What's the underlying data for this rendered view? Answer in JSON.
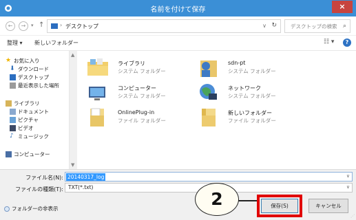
{
  "window": {
    "title": "名前を付けて保存",
    "close_label": "×"
  },
  "address_bar": {
    "path": "デスクトップ",
    "search_placeholder": "デスクトップの検索"
  },
  "toolbar": {
    "organize_label": "整理 ▾",
    "new_folder_label": "新しいフォルダー"
  },
  "sidebar": {
    "items": [
      {
        "label": "お気に入り",
        "icon": "star-icon"
      },
      {
        "label": "ダウンロード",
        "icon": "download-icon"
      },
      {
        "label": "デスクトップ",
        "icon": "desktop-icon"
      },
      {
        "label": "最近表示した場所",
        "icon": "recent-places-icon"
      },
      {
        "label": "ライブラリ",
        "icon": "library-icon"
      },
      {
        "label": "ドキュメント",
        "icon": "documents-icon"
      },
      {
        "label": "ピクチャ",
        "icon": "pictures-icon"
      },
      {
        "label": "ビデオ",
        "icon": "videos-icon"
      },
      {
        "label": "ミュージック",
        "icon": "music-icon"
      },
      {
        "label": "コンピューター",
        "icon": "computer-icon"
      }
    ]
  },
  "files": [
    {
      "name": "ライブラリ",
      "type": "システム フォルダー",
      "icon": "library-folder-icon"
    },
    {
      "name": "sdn-pt",
      "type": "システム フォルダー",
      "icon": "user-folder-icon"
    },
    {
      "name": "コンピューター",
      "type": "システム フォルダー",
      "icon": "computer-icon"
    },
    {
      "name": "ネットワーク",
      "type": "システム フォルダー",
      "icon": "network-icon"
    },
    {
      "name": "OnlinePlug-in",
      "type": "ファイル フォルダー",
      "icon": "folder-icon"
    },
    {
      "name": "新しいフォルダー",
      "type": "ファイル フォルダー",
      "icon": "folder-icon"
    }
  ],
  "form": {
    "filename_label": "ファイル名(N):",
    "filename_value": "20140317_log",
    "filetype_label": "ファイルの種類(T):",
    "filetype_value": "TXT(*.txt)",
    "hide_folders_label": "フォルダーの非表示"
  },
  "buttons": {
    "save_label": "保存(S)",
    "cancel_label": "キャンセル"
  },
  "callout": {
    "step_number": "2"
  },
  "colors": {
    "titlebar": "#3b8fd6",
    "close": "#c7443f",
    "highlight": "#e10000",
    "selection": "#3399ff"
  }
}
